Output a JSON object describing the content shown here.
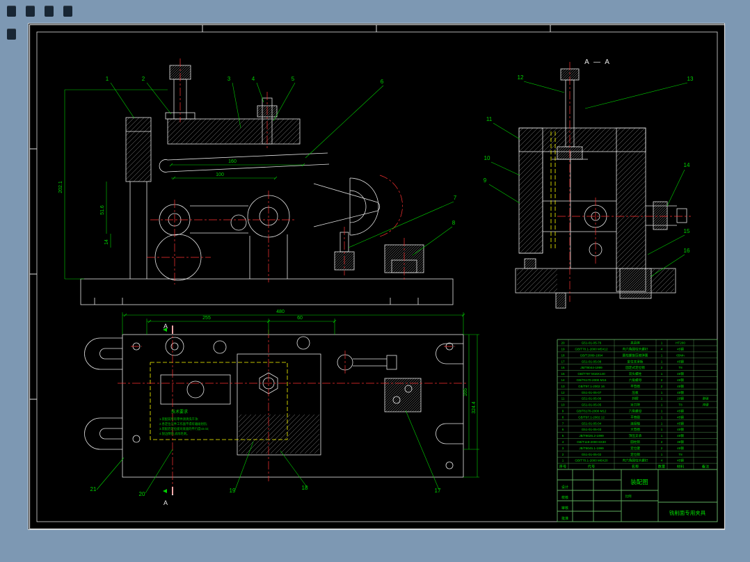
{
  "page": {
    "colors": {
      "background": "#7d98b3",
      "sheet": "#000000",
      "lines": "#e6e6e6",
      "dimension": "#00d400",
      "centerline": "#ff3232",
      "auxiliary": "#ffff00",
      "table_text": "#00dd00"
    }
  },
  "drawing": {
    "section_label": "A — A",
    "section_letter": "A",
    "balloons": [
      "1",
      "2",
      "3",
      "4",
      "5",
      "6",
      "7",
      "8",
      "9",
      "10",
      "11",
      "12",
      "13",
      "14",
      "15",
      "16",
      "17",
      "18",
      "19",
      "20",
      "21"
    ],
    "dimensions": {
      "front_width_160": "160",
      "front_width_100": "100",
      "front_height_51": "51.6",
      "front_height_14": "14",
      "front_height_total": "202.1",
      "plan_width_255": "255",
      "plan_width_480": "480",
      "plan_width_60": "60",
      "plan_depth_165": "165",
      "plan_depth_total": "324.4"
    },
    "tech_requirements": {
      "title": "技术要求",
      "lines": [
        "1.装配前所有零件须清洗干净;",
        "2.各定位元件工作面不得有磕碰划伤;",
        "3.装配后定位面对底面的平行度≤0.02;",
        "4.锐边倒钝,去除毛刺。"
      ]
    },
    "parts_table": {
      "headers": [
        "序号",
        "代号",
        "名称",
        "数量",
        "材料",
        "备注"
      ],
      "rows": [
        [
          "20",
          "G51-01-05-76",
          "夹具体",
          "1",
          "HT200",
          ""
        ],
        [
          "19",
          "GB/T70.1-2000 M5X12",
          "内六角圆柱头螺钉",
          "4",
          "45钢",
          ""
        ],
        [
          "18",
          "GB/T2089-1994",
          "圆柱螺旋压缩弹簧",
          "1",
          "65Mn",
          ""
        ],
        [
          "17",
          "G51-01-05-08",
          "定位支承板",
          "1",
          "45钢",
          ""
        ],
        [
          "16",
          "JB/T8044-1999",
          "固定式定位销",
          "2",
          "T8",
          ""
        ],
        [
          "15",
          "GB/T797 M16X140",
          "双头螺柱",
          "1",
          "45钢",
          ""
        ],
        [
          "14",
          "GB/T6170-2000 M16",
          "六角螺母",
          "2",
          "45钢",
          ""
        ],
        [
          "13",
          "GB/T97.1-2002 16",
          "平垫圈",
          "2",
          "45钢",
          ""
        ],
        [
          "12",
          "G51-01-05-07",
          "压板",
          "1",
          "45钢",
          ""
        ],
        [
          "11",
          "G51-01-05-06",
          "斜楔",
          "1",
          "20钢",
          "渗碳"
        ],
        [
          "10",
          "G51-01-05-05",
          "对刀块",
          "1",
          "T8",
          "淬硬"
        ],
        [
          "9",
          "GB/T6170-2000 M12",
          "六角螺母",
          "1",
          "45钢",
          ""
        ],
        [
          "8",
          "GB/T97.1-2002 12",
          "平垫圈",
          "1",
          "45钢",
          ""
        ],
        [
          "7",
          "G51-01-05-04",
          "连接轴",
          "1",
          "45钢",
          ""
        ],
        [
          "6",
          "G51-01-05-03",
          "大垫圈",
          "1",
          "45钢",
          ""
        ],
        [
          "5",
          "JB/T8026.2-1999",
          "顶压支承",
          "1",
          "45钢",
          ""
        ],
        [
          "4",
          "GB/T119-2000 6X30",
          "圆柱销",
          "2",
          "35钢",
          ""
        ],
        [
          "3",
          "JB/T8045.1-1999",
          "定位键",
          "2",
          "45钢",
          ""
        ],
        [
          "2",
          "G51-01-05-02",
          "定位销",
          "1",
          "T8",
          ""
        ],
        [
          "1",
          "GB/T70.1-2000 M6X20",
          "内六角圆柱头螺钉",
          "4",
          "45钢",
          ""
        ]
      ]
    },
    "title_block": {
      "drawing_type": "装配图",
      "fixture_name": "铣削面专用夹具",
      "labels": [
        "设计",
        "校核",
        "审核",
        "批准"
      ],
      "scale_label": "比例"
    }
  }
}
